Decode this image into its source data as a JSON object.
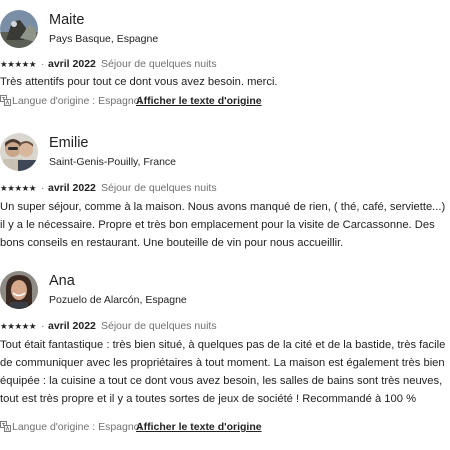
{
  "reviews": [
    {
      "name": "Maite",
      "location": "Pays Basque, Espagne",
      "stars": "★★★★★",
      "date": "avril 2022",
      "stay": "Séjour de quelques nuits",
      "text": "Très attentifs pour tout ce dont vous avez besoin. merci.",
      "translation": {
        "label": "Langue d'origine : Espagnol",
        "link": "Afficher le texte d'origine"
      },
      "avatar_icon": "avatar-photo-landscape"
    },
    {
      "name": "Emilie",
      "location": "Saint-Genis-Pouilly, France",
      "stars": "★★★★★",
      "date": "avril 2022",
      "stay": "Séjour de quelques nuits",
      "text": "Un super séjour, comme à la maison. Nous avons manqué de rien, ( thé, café, serviette...) il y a le nécessaire. Propre et très bon emplacement pour la visite de Carcassonne. Des bons conseils en restaurant. Une bouteille de vin pour nous accueillir.",
      "avatar_icon": "avatar-photo-couple"
    },
    {
      "name": "Ana",
      "location": "Pozuelo de Alarcón, Espagne",
      "stars": "★★★★★",
      "date": "avril 2022",
      "stay": "Séjour de quelques nuits",
      "text": "Tout était fantastique : très bien situé, à quelques pas de la cité et de la bastide, très facile de communiquer avec les propriétaires à tout moment. La maison est également très bien équipée : la cuisine a tout ce dont vous avez besoin, les salles de bains sont très neuves, tout est très propre et il y a toutes sortes de jeux de société ! Recommandé à 100 %",
      "translation": {
        "label": "Langue d'origine : Espagnol",
        "link": "Afficher le texte d'origine"
      },
      "avatar_icon": "avatar-photo-woman"
    }
  ],
  "icons": {
    "translate": "translate-icon",
    "star": "star-icon"
  }
}
